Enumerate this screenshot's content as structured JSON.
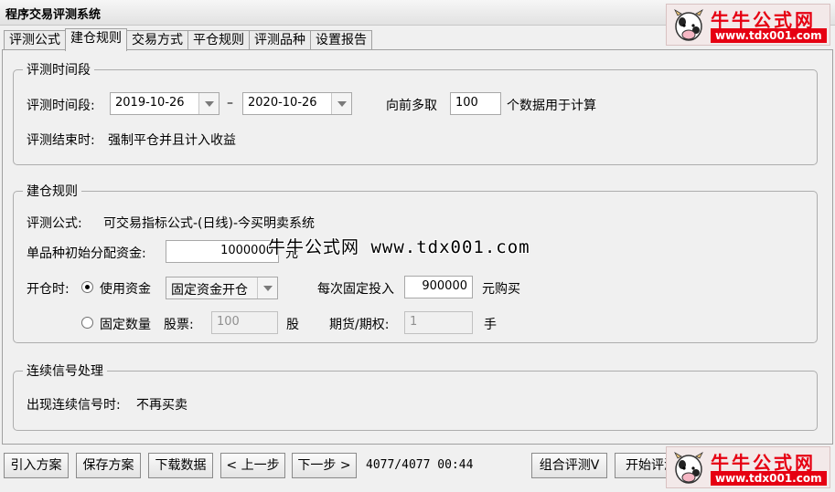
{
  "window": {
    "title": "程序交易评测系统"
  },
  "logo": {
    "brand": "牛牛公式网",
    "url": "www.tdx001.com"
  },
  "tabs": [
    {
      "label": "评测公式"
    },
    {
      "label": "建仓规则"
    },
    {
      "label": "交易方式"
    },
    {
      "label": "平仓规则"
    },
    {
      "label": "评测品种"
    },
    {
      "label": "设置报告"
    }
  ],
  "period": {
    "legend": "评测时间段",
    "range_label": "评测时间段:",
    "start_date": "2019-10-26",
    "dash": "–",
    "end_date": "2020-10-26",
    "lookback_label": "向前多取",
    "lookback_value": "100",
    "lookback_suffix": "个数据用于计算",
    "end_rule_label": "评测结束时:",
    "end_rule_value": "强制平仓并且计入收益"
  },
  "build": {
    "legend": "建仓规则",
    "formula_label": "评测公式:",
    "formula_value": "可交易指标公式-(日线)-今买明卖系统",
    "capital_label": "单品种初始分配资金:",
    "capital_value": "1000000",
    "capital_unit": "元",
    "open_label": "开仓时:",
    "use_capital_label": "使用资金",
    "capital_mode_value": "固定资金开仓",
    "fixed_invest_label": "每次固定投入",
    "fixed_invest_value": "900000",
    "fixed_invest_suffix": "元购买",
    "fixed_qty_label": "固定数量",
    "stock_label": "股票:",
    "stock_value": "100",
    "stock_unit": "股",
    "futures_label": "期货/期权:",
    "futures_value": "1",
    "futures_unit": "手"
  },
  "signal": {
    "legend": "连续信号处理",
    "rule_label": "出现连续信号时:",
    "rule_value": "不再买卖"
  },
  "watermark": "牛牛公式网 www.tdx001.com",
  "bottom": {
    "import_label": "引入方案",
    "save_label": "保存方案",
    "download_label": "下载数据",
    "prev_label": "< 上一步",
    "next_label": "下一步 >",
    "status": "4077/4077 00:44",
    "combo_label": "组合评测V",
    "start_label": "开始评测"
  }
}
